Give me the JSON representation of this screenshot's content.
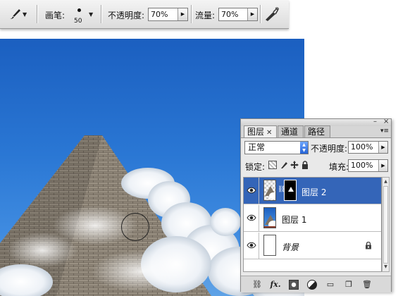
{
  "options_bar": {
    "brush_label": "画笔:",
    "brush_size": "50",
    "opacity_label": "不透明度:",
    "opacity_value": "70%",
    "flow_label": "流量:",
    "flow_value": "70%"
  },
  "layers_panel": {
    "tabs": [
      {
        "label": "图层",
        "active": true
      },
      {
        "label": "通道",
        "active": false
      },
      {
        "label": "路径",
        "active": false
      }
    ],
    "blend_mode": "正常",
    "opacity_label": "不透明度:",
    "opacity_value": "100%",
    "lock_label": "锁定:",
    "fill_label": "填充:",
    "fill_value": "100%",
    "layers": [
      {
        "name": "图层 2",
        "selected": true,
        "has_mask": true
      },
      {
        "name": "图层 1",
        "selected": false,
        "has_mask": false
      },
      {
        "name": "背景",
        "selected": false,
        "locked": true
      }
    ],
    "bottom_icons": [
      "link-icon",
      "fx-icon",
      "mask-icon",
      "adjustment-icon",
      "group-icon",
      "new-layer-icon",
      "trash-icon"
    ],
    "bottom_fx": "fx."
  },
  "colors": {
    "selection": "#3465b8",
    "sky": "#2a77d4"
  }
}
